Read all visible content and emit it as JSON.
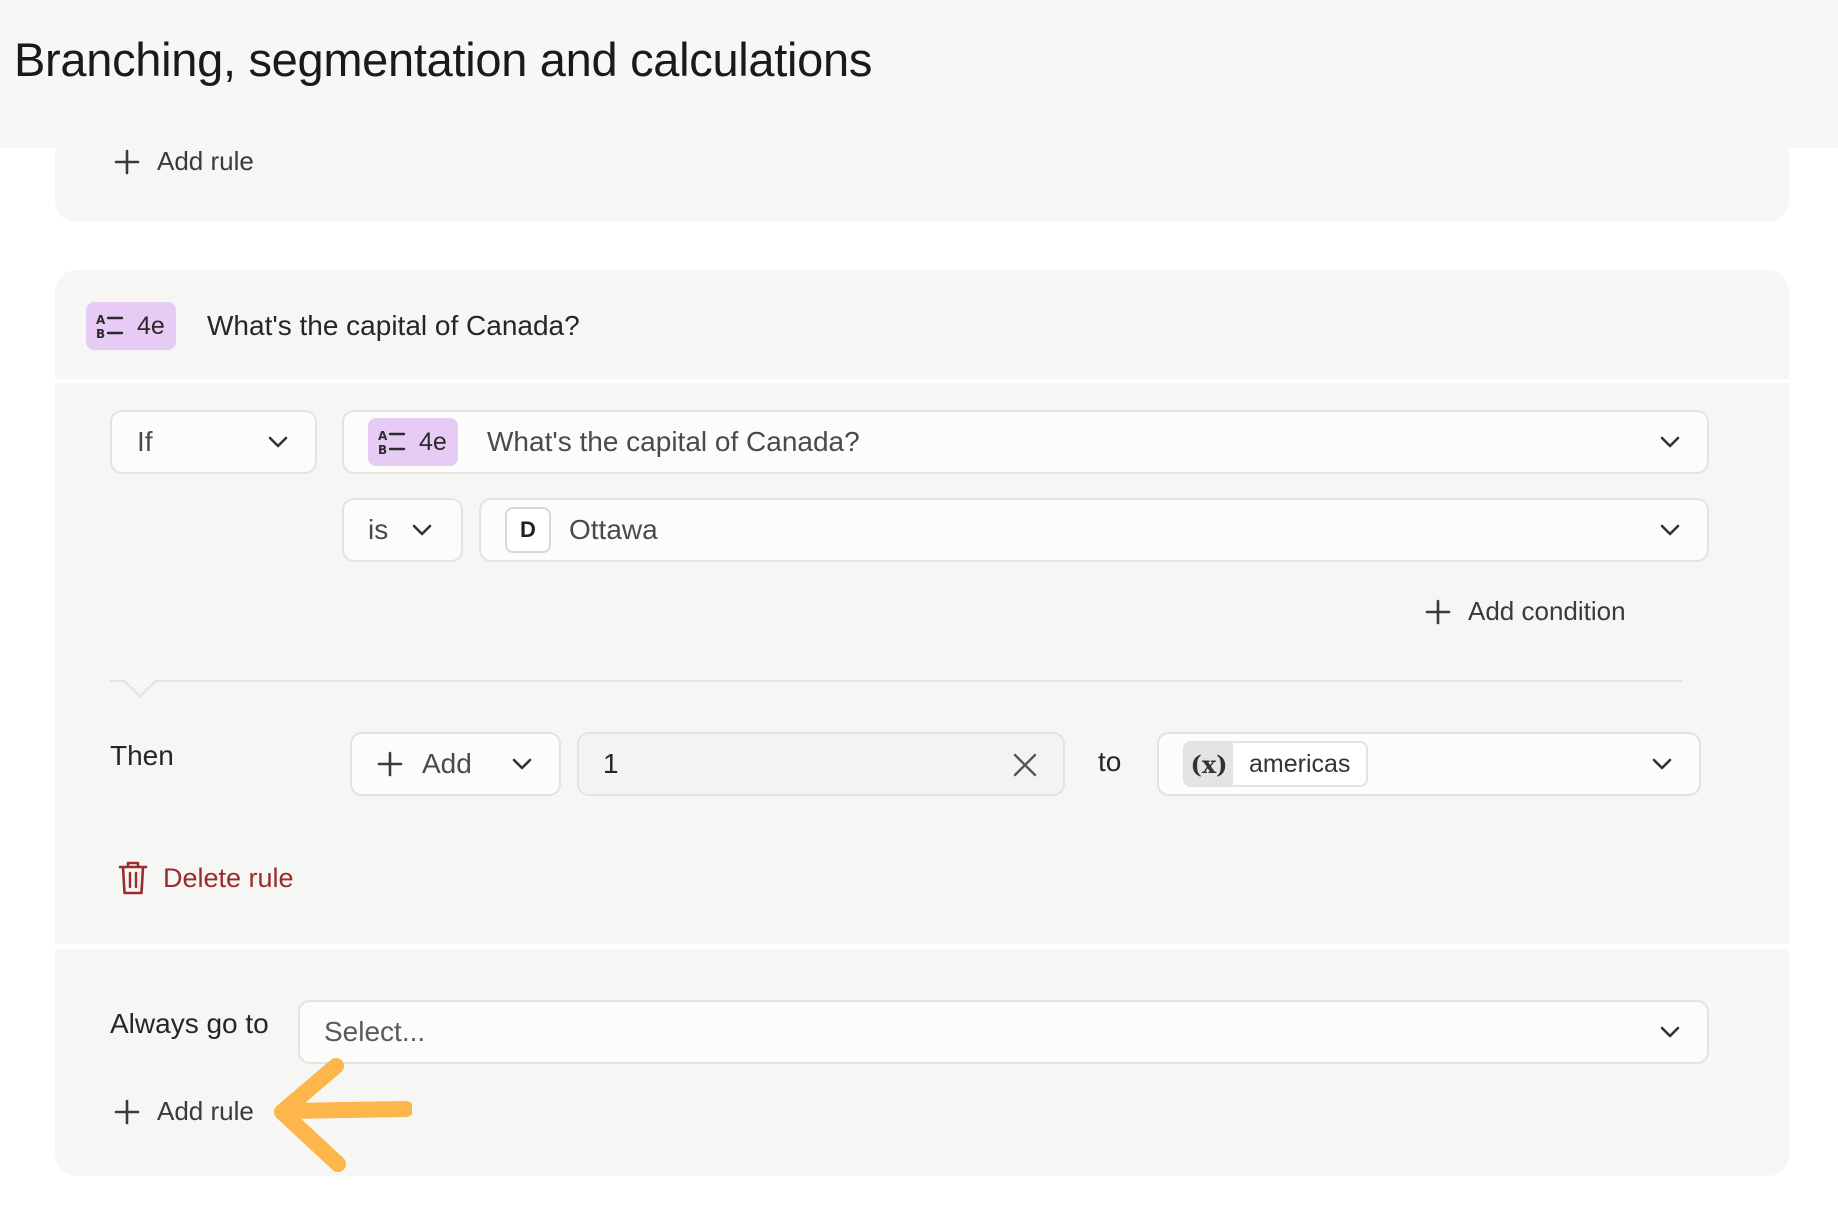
{
  "page": {
    "title": "Branching, segmentation and calculations"
  },
  "top_card": {
    "add_rule_label": "Add rule"
  },
  "question": {
    "badge_label": "4e",
    "title": "What's the capital of Canada?"
  },
  "rule": {
    "if_select": "If",
    "question_select": {
      "badge_label": "4e",
      "value": "What's the capital of Canada?"
    },
    "operator_select": "is",
    "answer_select": {
      "key": "D",
      "value": "Ottawa"
    },
    "add_condition_label": "Add condition",
    "then_label": "Then",
    "action_select": "Add",
    "amount_value": "1",
    "to_label": "to",
    "variable_select": {
      "symbol": "(x)",
      "name": "americas"
    },
    "delete_rule_label": "Delete rule"
  },
  "always": {
    "label": "Always go to",
    "placeholder": "Select...",
    "add_rule_label": "Add rule"
  },
  "colors": {
    "badge_bg": "#e6ccf5",
    "delete_red": "#9b2c2c",
    "arrow_orange": "#fdb64a",
    "card_bg": "#f6f6f5"
  },
  "icons": {
    "plus": "plus-icon",
    "chevron": "chevron-down-icon",
    "multiple_choice": "multiple-choice-icon",
    "trash": "trash-icon",
    "clear": "close-icon",
    "variable": "variable-icon",
    "annotation": "arrow-annotation-icon"
  }
}
